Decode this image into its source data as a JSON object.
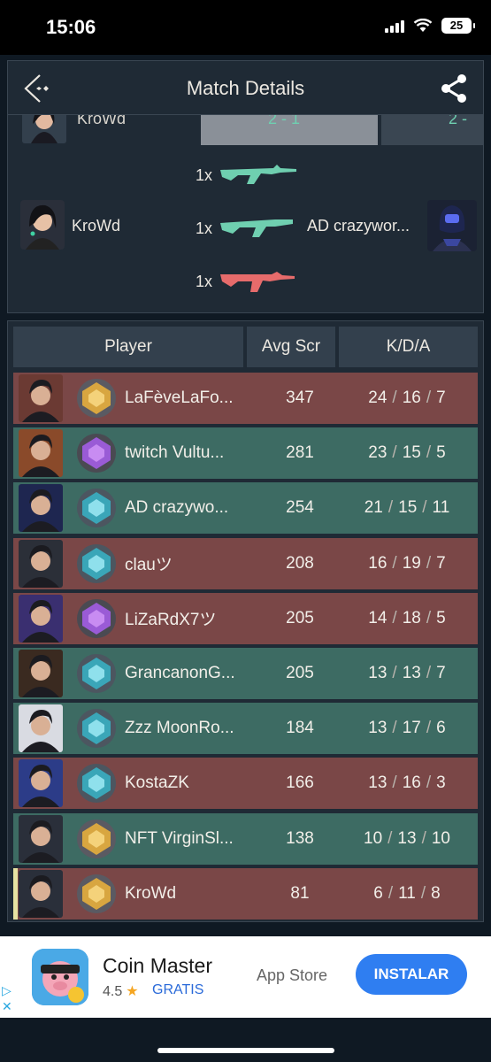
{
  "status_bar": {
    "time": "15:06",
    "battery": "25"
  },
  "header": {
    "title": "Match Details"
  },
  "duel": {
    "top_name": "KroWd",
    "top_left_score": "2 - 1",
    "top_right_score": "2 -",
    "kills": [
      {
        "count": "1x",
        "weapon_icon": "rifle-icon",
        "color": "#6fcfb0"
      },
      {
        "count": "1x",
        "weapon_icon": "rifle-icon",
        "color": "#6fcfb0"
      },
      {
        "count": "1x",
        "weapon_icon": "rifle-icon",
        "color": "#e66b6b"
      }
    ],
    "left_player": "KroWd",
    "right_player": "AD crazywor..."
  },
  "scoreboard": {
    "headers": {
      "player": "Player",
      "avg_score": "Avg Scr",
      "kda": "K/D/A"
    },
    "rows": [
      {
        "team": "red",
        "name": "LaFèveLaFo...",
        "rank": "gold",
        "score": "347",
        "k": "24",
        "d": "16",
        "a": "7",
        "self": false
      },
      {
        "team": "green",
        "name": "twitch Vultu...",
        "rank": "amethyst",
        "score": "281",
        "k": "23",
        "d": "15",
        "a": "5",
        "self": false
      },
      {
        "team": "green",
        "name": "AD crazywo...",
        "rank": "platinum",
        "score": "254",
        "k": "21",
        "d": "15",
        "a": "11",
        "self": false
      },
      {
        "team": "red",
        "name": "clauツ",
        "rank": "platinum",
        "score": "208",
        "k": "16",
        "d": "19",
        "a": "7",
        "self": false
      },
      {
        "team": "red",
        "name": "LiZaRdX7ツ",
        "rank": "amethyst",
        "score": "205",
        "k": "14",
        "d": "18",
        "a": "5",
        "self": false
      },
      {
        "team": "green",
        "name": "GrancanonG...",
        "rank": "platinum",
        "score": "205",
        "k": "13",
        "d": "13",
        "a": "7",
        "self": false
      },
      {
        "team": "green",
        "name": "Zzz MoonRo...",
        "rank": "platinum",
        "score": "184",
        "k": "13",
        "d": "17",
        "a": "6",
        "self": false
      },
      {
        "team": "red",
        "name": "KostaZK",
        "rank": "platinum",
        "score": "166",
        "k": "13",
        "d": "16",
        "a": "3",
        "self": false
      },
      {
        "team": "green",
        "name": "NFT VirginSl...",
        "rank": "gold",
        "score": "138",
        "k": "10",
        "d": "13",
        "a": "10",
        "self": false
      },
      {
        "team": "red",
        "name": "KroWd",
        "rank": "gold",
        "score": "81",
        "k": "6",
        "d": "11",
        "a": "8",
        "self": true
      }
    ]
  },
  "ad": {
    "title": "Coin Master",
    "rating": "4.5",
    "price": "GRATIS",
    "store": "App Store",
    "install": "INSTALAR"
  }
}
